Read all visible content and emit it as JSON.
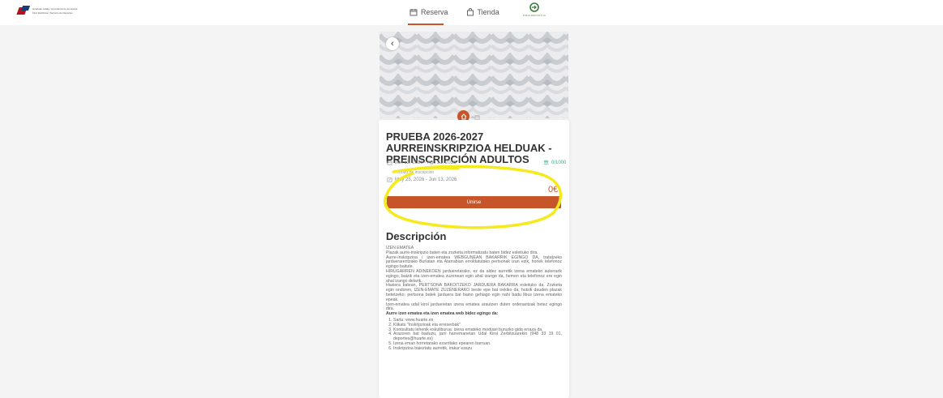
{
  "header": {
    "logo_line1": "Huarteko Udala / Ayuntamiento de Huarte",
    "logo_line2": "Kirol Zerbitzua / Servicio de Deportes",
    "nav": [
      {
        "label": "Reserva",
        "icon": "calendar-icon",
        "active": true
      },
      {
        "label": "Tienda",
        "icon": "shopping-bag-icon",
        "active": false
      }
    ],
    "brand_text": "KIROLDEPORTUA",
    "accent_color": "#c6552a"
  },
  "activity": {
    "title": "PRUEBA 2026-2027 AURREINSKRIPZIOA HELDUAK - PREINSCRIPCIÓN ADULTOS",
    "dates": "Jun 13, 2026 - Ago 31, 2026",
    "capacity": "0/1000",
    "inscription_label": "Periodo de inscripción",
    "inscription_dates": "May 25, 2026 - Jun 13, 2026",
    "price": "0€",
    "join_label": "Unirse"
  },
  "description": {
    "title": "Descripción",
    "heading": "IZEN EMATEA",
    "paragraphs": [
      "Plazak aurre-inskripzio baten eta zozketa informatizatu baten bidez esleituko dira.",
      "Aurre-inskripzioa / izen-ematea WEBGUNEAN BAKARRIK EGINGO DA, tratatzeko jarduerarentzako Burlatan eta Atarrabian erroldatutako pertsonak izan ezik, horiek telefonoz egingo baitute.",
      "HIRUGARREN ADINEKOEN jardueretarako, ez da aldez aurretik izena emateko aukerarik egingo, baizik eta izen-ematea zuzenean egin ahal izango da, hemen eta telefonoz ere egin ahal izango delarik.",
      "Hasiera batean, PERTSONA BAKOITZEKO JARDUERA BAKARRA esleituko da. Zozketa egin ondoren, IZEN-EMATE ZUZENERAKO beste epe bat irekiko da, hutsik dauden plazak betetzeko; pertsona batek jarduera bat baino gehiago egin nahi badu libus izena emateko epeak.",
      "Izen-ematea udal kirol jardueretan izena ematea arautzen duten ordenantzak betez egingo dira."
    ],
    "steps_title": "Aurre izen ematea eta izen ematea web bidez egingo da:",
    "steps": [
      "Sartu: www.huarte.es",
      "Klikatu \"Inskripzioak eta erreserbak\"",
      "Kontsultatu lehenik eskuliburua: izena emateko moduari buruzko gida erraza da.",
      "Arazoren bat baduzu, jarri harremanetan Udal Kirol Zerbitzuarekin (948 33 19 01, deportes@huarte.es)",
      "Izena eman horretarako ezarritako epearen barruan.",
      "Inskripzioa baieztatu aurretik, irakur ezazu"
    ]
  }
}
